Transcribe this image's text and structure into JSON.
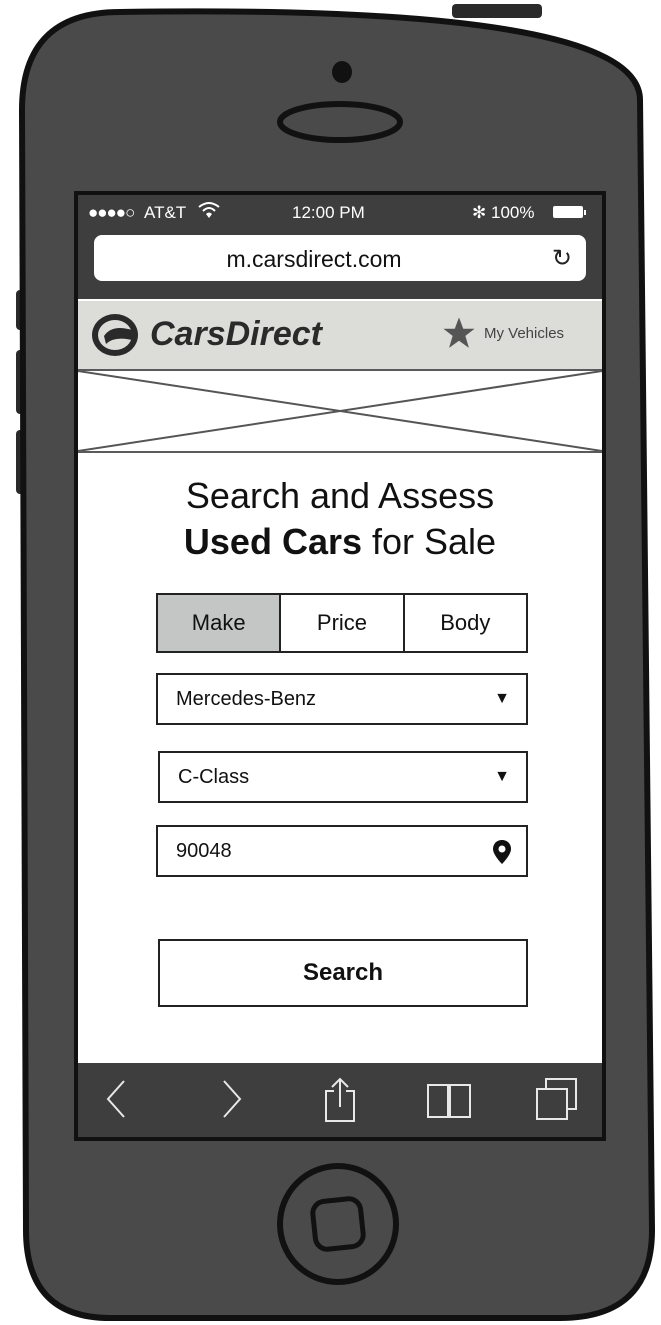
{
  "status_bar": {
    "signal": "●●●●○",
    "carrier": "AT&T",
    "time": "12:00 PM",
    "bluetooth": "✻",
    "battery": "100%"
  },
  "browser": {
    "url": "m.carsdirect.com",
    "reload_icon": "↻"
  },
  "header": {
    "logo_part1": "Cars",
    "logo_part2": "Direct",
    "favorites_label": "My Vehicles"
  },
  "page": {
    "title_line1": "Search and Assess",
    "title_bold": "Used Cars",
    "title_rest": " for Sale"
  },
  "tabs": [
    {
      "label": "Make",
      "active": true
    },
    {
      "label": "Price",
      "active": false
    },
    {
      "label": "Body",
      "active": false
    }
  ],
  "form": {
    "make": "Mercedes-Benz",
    "model": "C-Class",
    "zip": "90048",
    "dropdown_arrow": "▼",
    "search_label": "Search"
  },
  "colors": {
    "phone_body": "#4a4a4a",
    "bar": "#3e3e3e",
    "header_bg": "#dcdcd8",
    "active_tab": "#c4c6c5"
  }
}
